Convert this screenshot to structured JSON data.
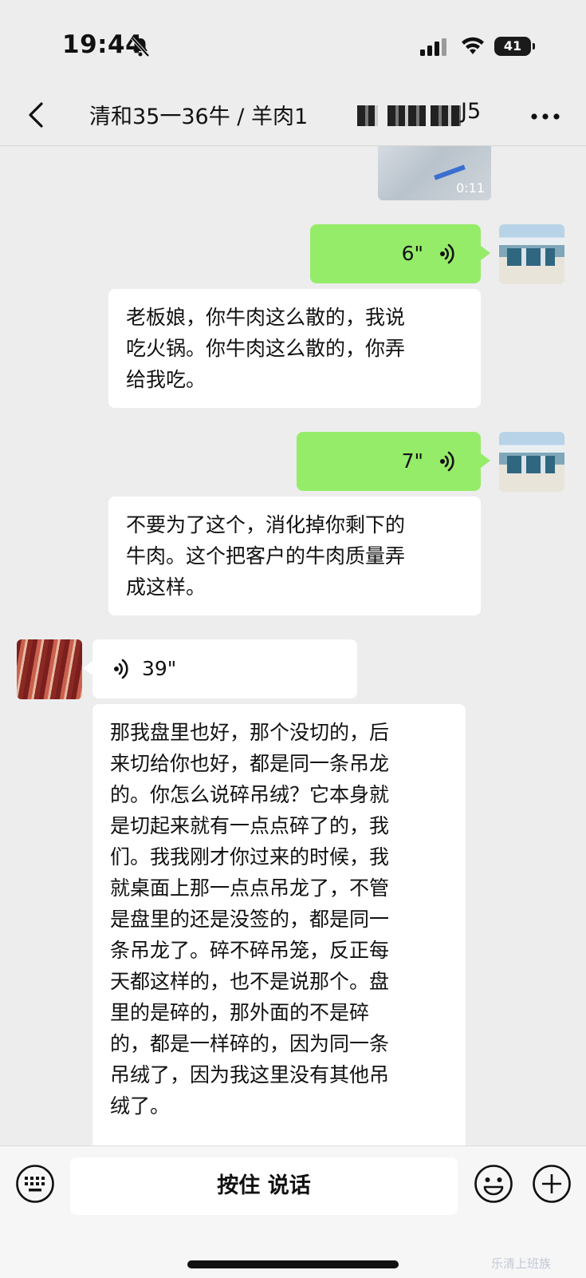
{
  "status_bar": {
    "time": "19:44",
    "battery": "41",
    "icons": [
      "bell-slash-icon",
      "signal-icon",
      "wifi-icon",
      "battery-icon"
    ]
  },
  "nav": {
    "back_icon": "chevron-left-icon",
    "title": "清和35一36牛 / 羊肉1",
    "title_tail": "J5",
    "more_icon": "more-dots-icon"
  },
  "messages": [
    {
      "type": "video",
      "from": "other",
      "duration": "0:11"
    },
    {
      "type": "voice",
      "from": "self",
      "length": "6\"",
      "transcript": [
        "老板娘，你牛肉这么散的，我说",
        "吃火锅。你牛肉这么散的，你弄",
        "给我吃。"
      ]
    },
    {
      "type": "voice",
      "from": "self",
      "length": "7\"",
      "transcript": [
        "不要为了这个，消化掉你剩下的",
        "牛肉。这个把客户的牛肉质量弄",
        "成这样。"
      ]
    },
    {
      "type": "voice",
      "from": "other",
      "length": "39\"",
      "transcript": [
        "那我盘里也好，那个没切的，后",
        "来切给你也好，都是同一条吊龙",
        "的。你怎么说碎吊绒？它本身就",
        "是切起来就有一点点碎了的，我",
        "们。我我刚才你过来的时候，我",
        "就桌面上那一点点吊龙了，不管",
        "是盘里的还是没签的，都是同一",
        "条吊龙了。碎不碎吊笼，反正每",
        "天都这样的，也不是说那个。盘",
        "里的是碎的，那外面的不是碎",
        "的，都是一样碎的，因为同一条",
        "吊绒了，因为我这里没有其他吊",
        "绒了。"
      ]
    }
  ],
  "bottom_bar": {
    "keyboard_icon": "keyboard-icon",
    "talk_label": "按住 说话",
    "emoji_icon": "emoji-icon",
    "plus_icon": "plus-circle-icon"
  },
  "watermark": "乐清上班族",
  "colors": {
    "outgoing_bubble": "#95ec69",
    "incoming_bubble": "#ffffff",
    "background": "#ededed"
  }
}
